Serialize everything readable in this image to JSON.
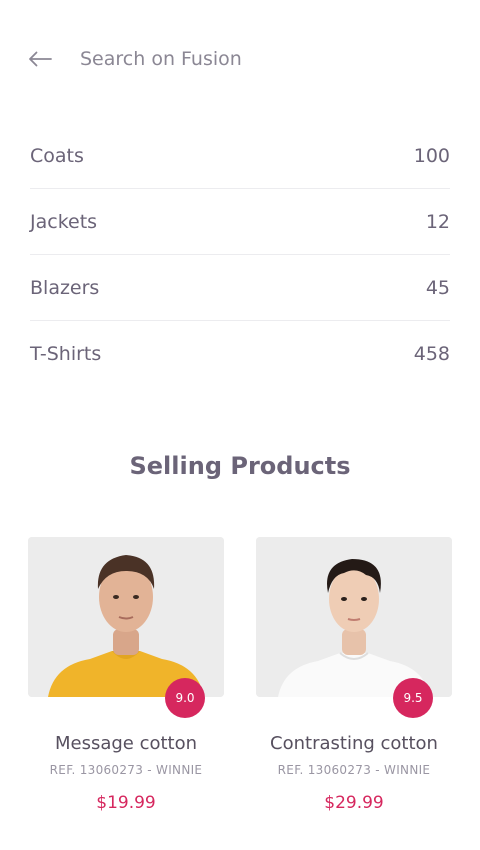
{
  "search": {
    "back_icon": "arrow-left-icon",
    "placeholder": "Search on Fusion"
  },
  "categories": [
    {
      "name": "Coats",
      "count": "100"
    },
    {
      "name": "Jackets",
      "count": "12"
    },
    {
      "name": "Blazers",
      "count": "45"
    },
    {
      "name": "T-Shirts",
      "count": "458"
    }
  ],
  "section": {
    "title": "Selling Products"
  },
  "products": [
    {
      "name": "Message cotton",
      "ref": "REF. 13060273 - WINNIE",
      "price": "$19.99",
      "rating": "9.0",
      "image": "man-yellow-tshirt"
    },
    {
      "name": "Contrasting cotton",
      "ref": "REF. 13060273 - WINNIE",
      "price": "$29.99",
      "rating": "9.5",
      "image": "man-white-tshirt"
    }
  ],
  "colors": {
    "accent": "#d6275e",
    "text": "#6b6478",
    "divider": "#ececef",
    "photo_bg": "#ececec"
  }
}
